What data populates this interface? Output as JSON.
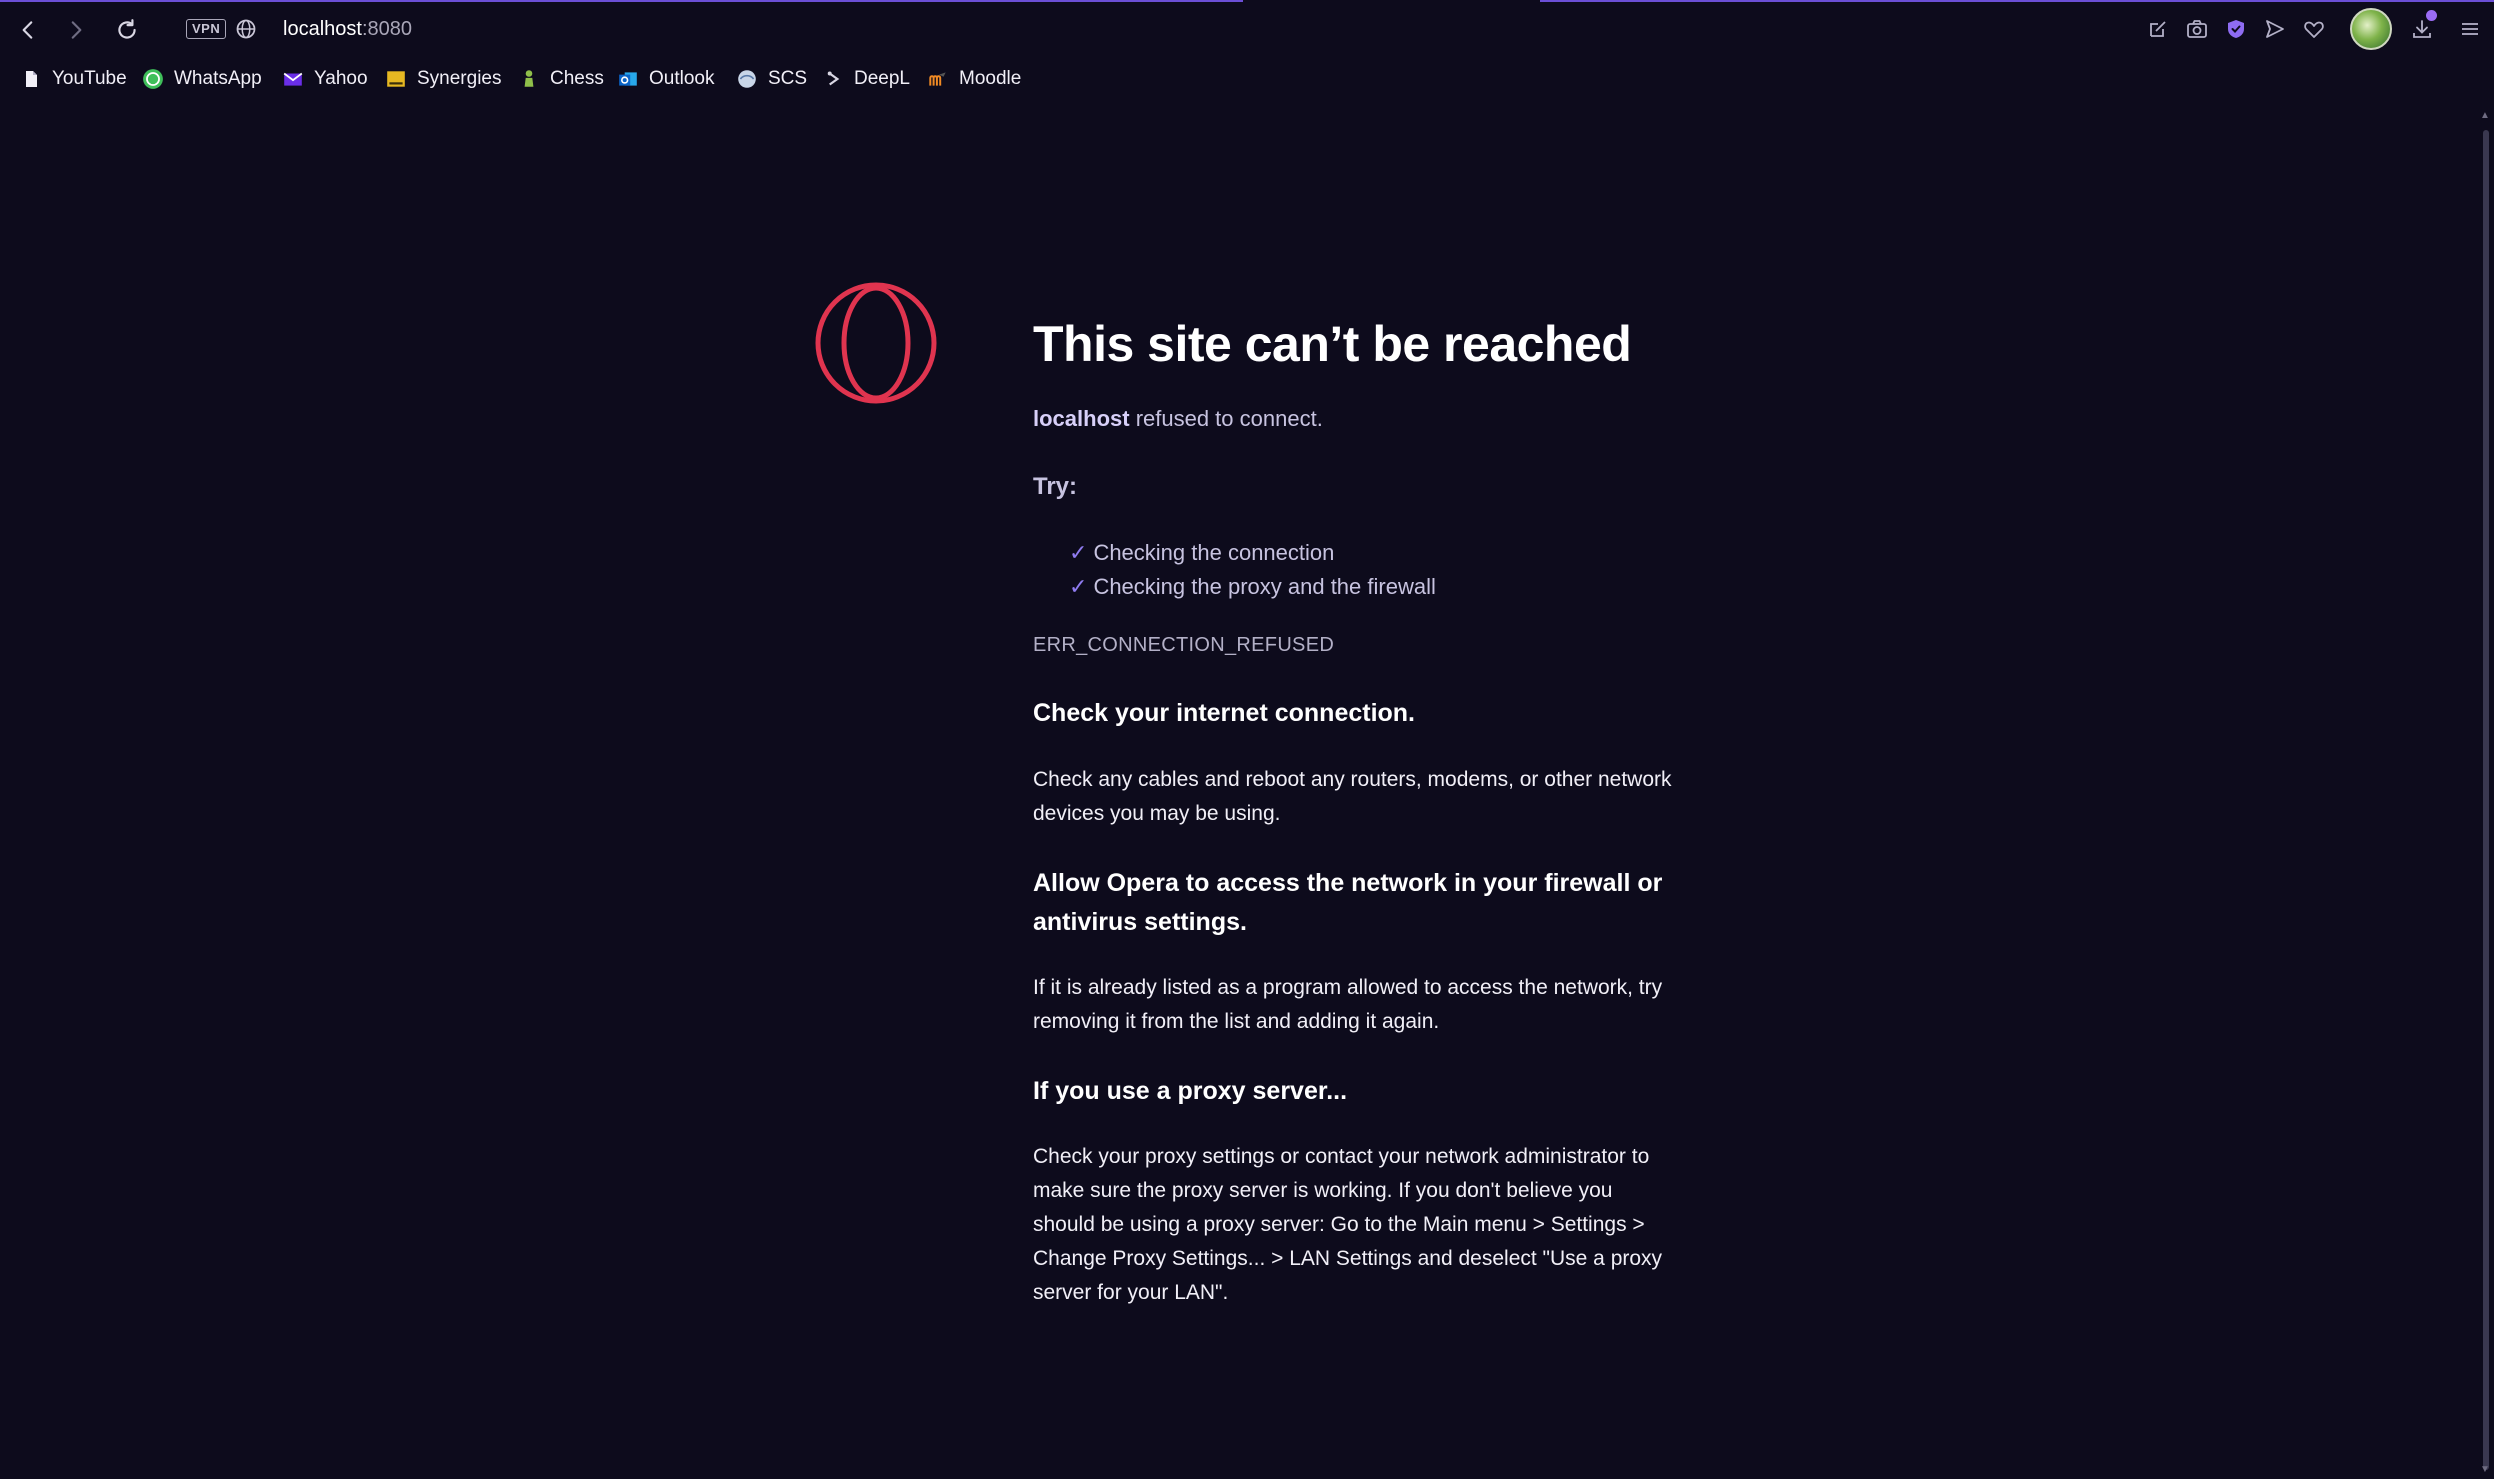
{
  "browser": {
    "url_host": "localhost",
    "url_port": ":8080",
    "vpn_label": "VPN",
    "accent_color": "#6b4fd6"
  },
  "bookmarks": [
    {
      "label": "YouTube",
      "icon": "page-icon"
    },
    {
      "label": "WhatsApp",
      "icon": "whatsapp-icon"
    },
    {
      "label": "Yahoo",
      "icon": "yahoo-mail-icon"
    },
    {
      "label": "Synergies",
      "icon": "synergies-icon"
    },
    {
      "label": "Chess",
      "icon": "chess-pawn-icon"
    },
    {
      "label": "Outlook",
      "icon": "outlook-icon"
    },
    {
      "label": "SCS",
      "icon": "scs-icon"
    },
    {
      "label": "DeepL",
      "icon": "deepl-icon"
    },
    {
      "label": "Moodle",
      "icon": "moodle-icon"
    }
  ],
  "toolbar_icons": [
    "edit-icon",
    "camera-icon",
    "shield-icon",
    "send-icon",
    "heart-icon",
    "download-icon",
    "menu-icon"
  ],
  "error": {
    "title": "This site can’t be reached",
    "host": "localhost",
    "host_suffix": " refused to connect.",
    "try_label": "Try:",
    "suggestions": [
      "Checking the connection",
      "Checking the proxy and the firewall"
    ],
    "check_mark": "✓",
    "code": "ERR_CONNECTION_REFUSED",
    "sections": [
      {
        "heading": "Check your internet connection.",
        "body": "Check any cables and reboot any routers, modems, or other network devices you may be using."
      },
      {
        "heading": "Allow Opera to access the network in your firewall or antivirus settings.",
        "body": "If it is already listed as a program allowed to access the network, try removing it from the list and adding it again."
      },
      {
        "heading": "If you use a proxy server...",
        "body": "Check your proxy settings or contact your network administrator to make sure the proxy server is working. If you don't believe you should be using a proxy server: Go to the Main menu > Settings > Change Proxy Settings... > LAN Settings and deselect \"Use a proxy server for your LAN\"."
      }
    ]
  },
  "logo_color": "#e0344f"
}
